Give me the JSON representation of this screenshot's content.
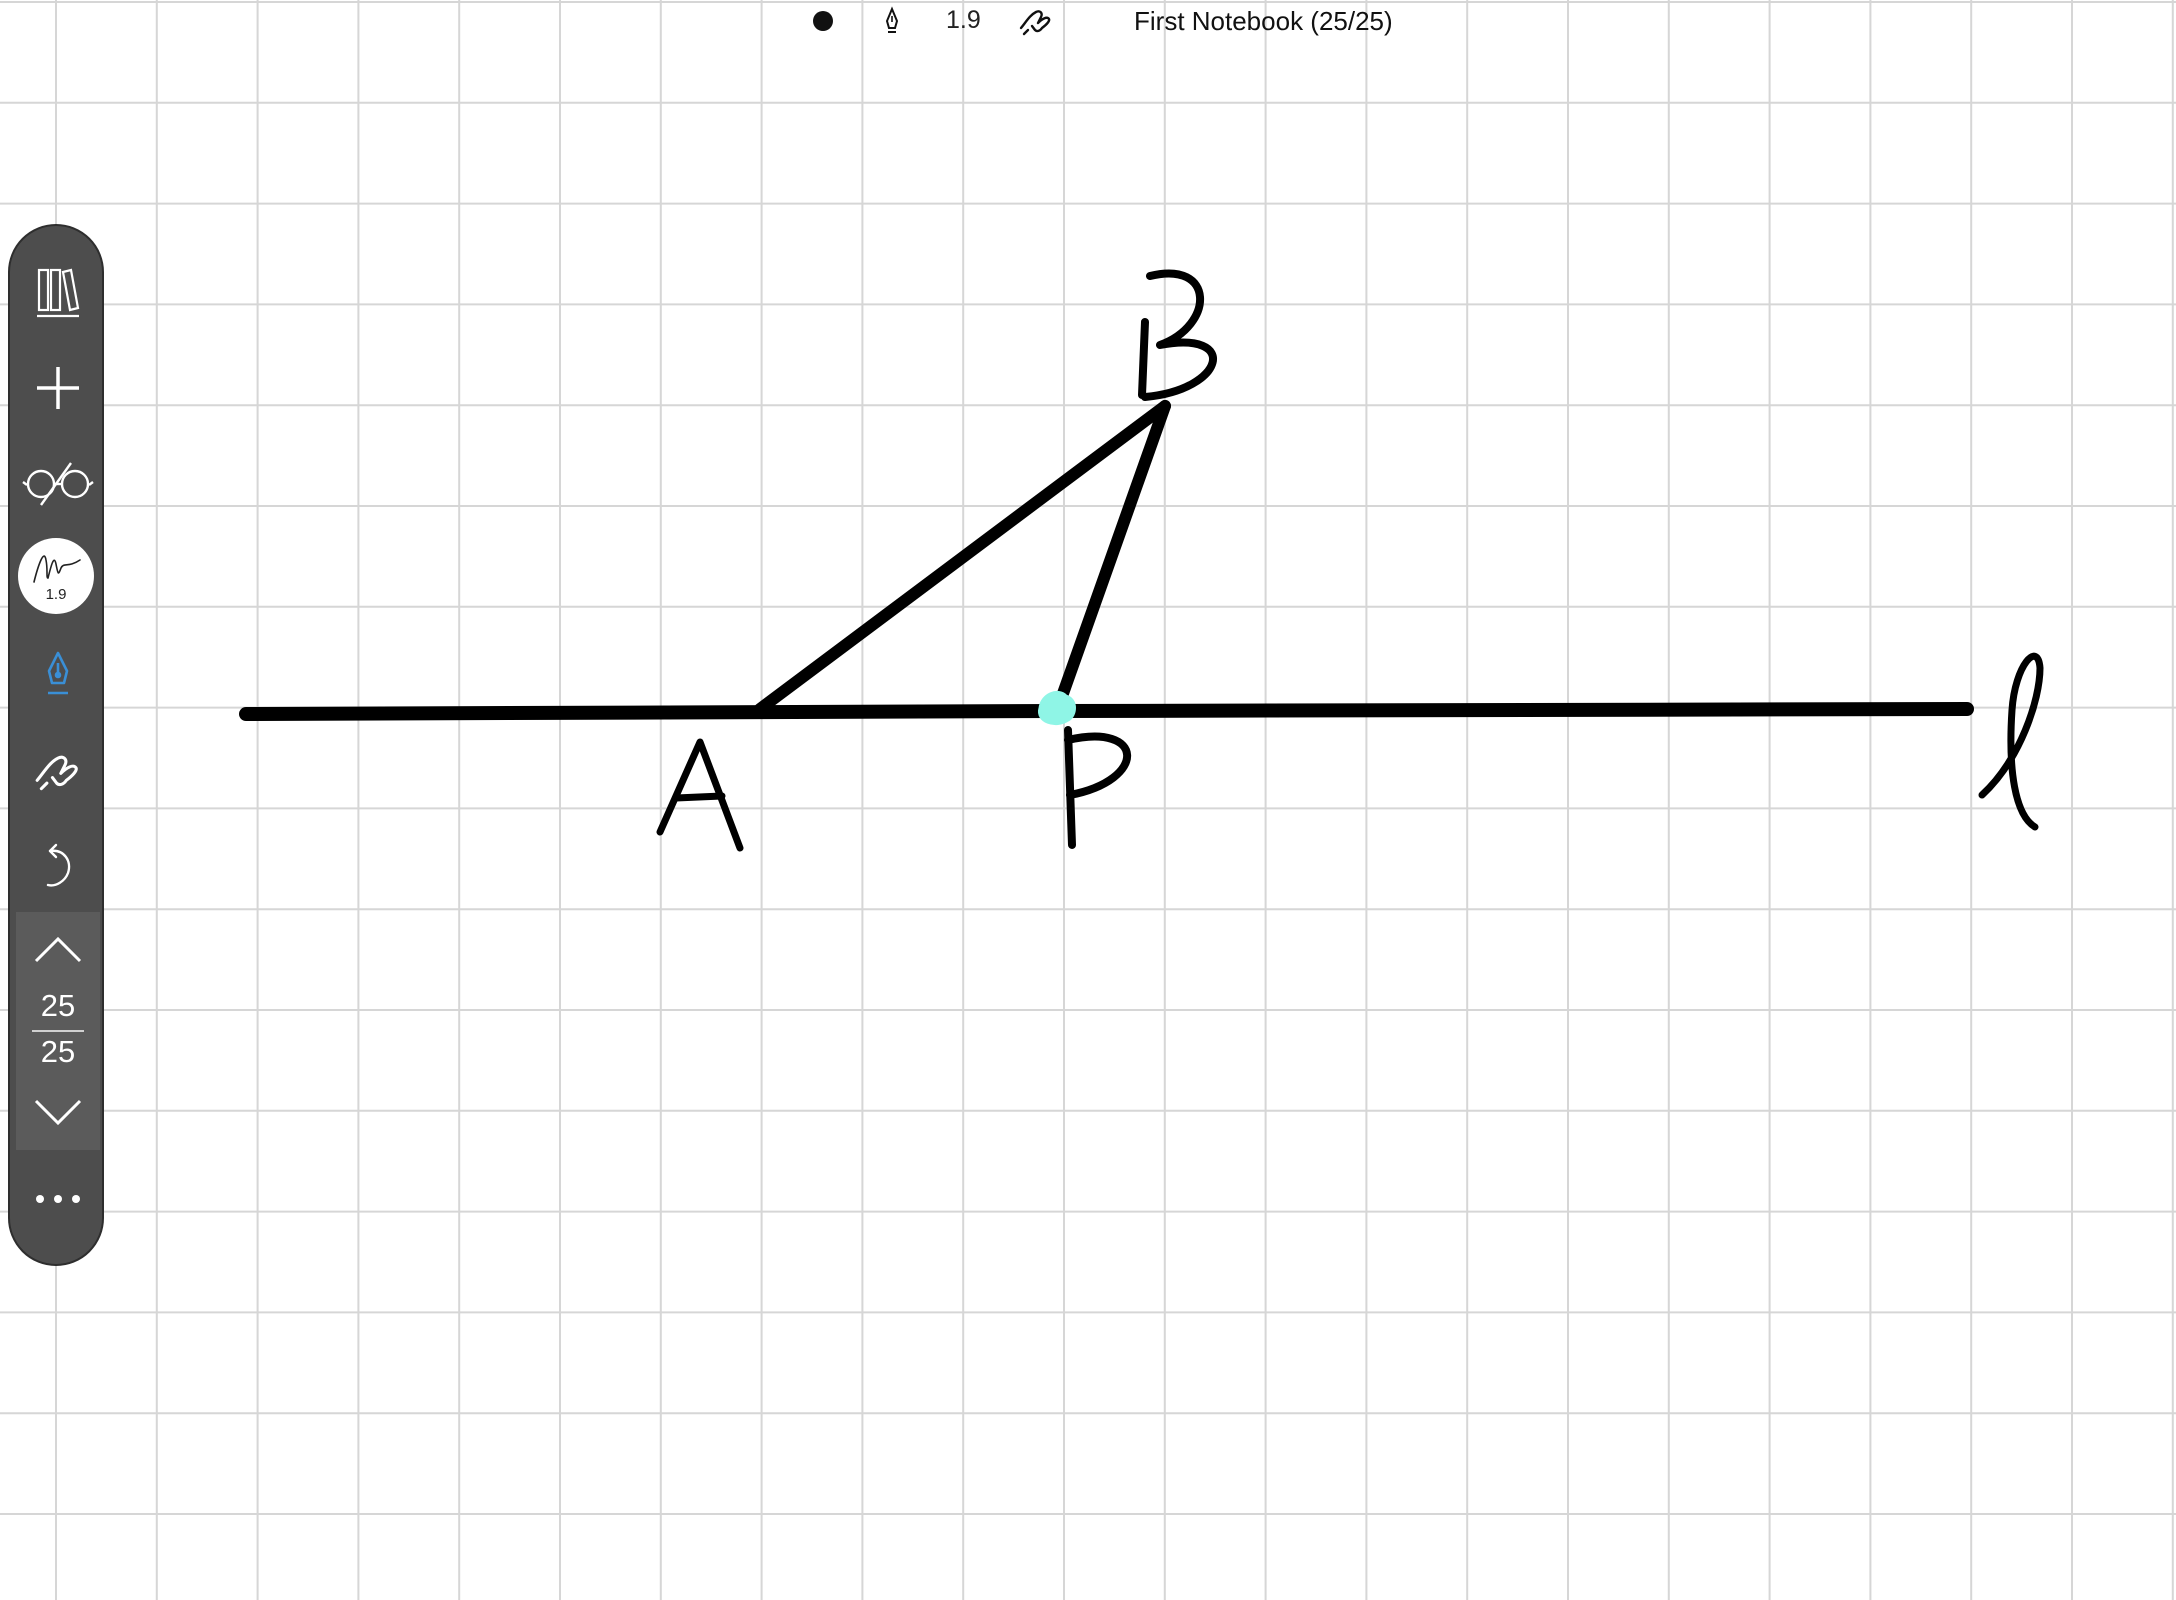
{
  "topbar": {
    "pen_size": "1.9",
    "title": "First Notebook (25/25)"
  },
  "toolbar": {
    "pen_preview_size": "1.9",
    "current_page": "25",
    "total_pages": "25",
    "active_tool": "pen",
    "active_color": "#3a8fd6",
    "icons": [
      "library-icon",
      "add-icon",
      "read-mode-icon",
      "pen-preview",
      "pen-icon",
      "hand-icon",
      "undo-icon",
      "page-up-icon",
      "page-down-icon",
      "more-icon"
    ]
  },
  "canvas": {
    "background": "#ffffff",
    "grid_color": "#d6d6d6",
    "ink_color": "#000000",
    "highlight_color": "#8ff5e6",
    "labels": [
      "A",
      "B",
      "P",
      "l"
    ]
  }
}
